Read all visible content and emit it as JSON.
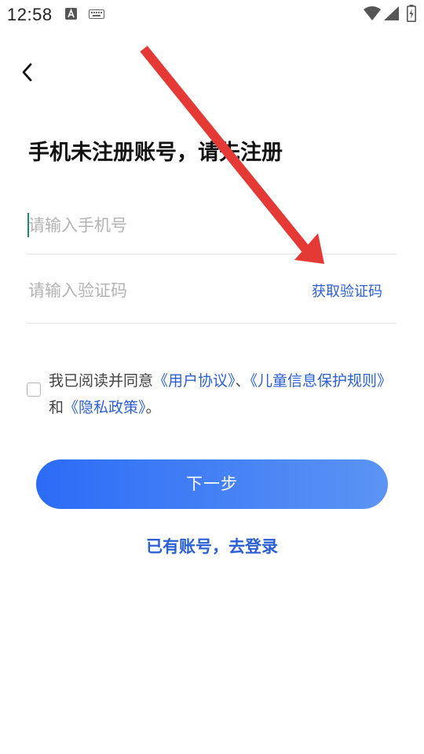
{
  "status_bar": {
    "time": "12:58",
    "icons": [
      "a-icon",
      "keyboard-icon",
      "wifi-icon",
      "signal-icon",
      "battery-icon"
    ]
  },
  "header": {
    "back_icon": "back-arrow-icon",
    "title": "手机未注册账号，请先注册"
  },
  "form": {
    "phone_placeholder": "请输入手机号",
    "phone_value": "",
    "code_placeholder": "请输入验证码",
    "code_value": "",
    "get_code_label": "获取验证码"
  },
  "agreement": {
    "checked": false,
    "prefix": "我已阅读并同意",
    "user_agreement": "《用户协议》",
    "separator": "、",
    "child_privacy": "《儿童信息保护规则》",
    "and": "和",
    "privacy_policy": "《隐私政策》",
    "suffix": "。"
  },
  "actions": {
    "next_label": "下一步",
    "login_label": "已有账号，去登录"
  },
  "colors": {
    "accent": "#2a5fd6",
    "button_start": "#2b6cf6",
    "button_end": "#5c94f4",
    "annotation_arrow": "#e53935",
    "cursor": "#1a8a6e"
  }
}
